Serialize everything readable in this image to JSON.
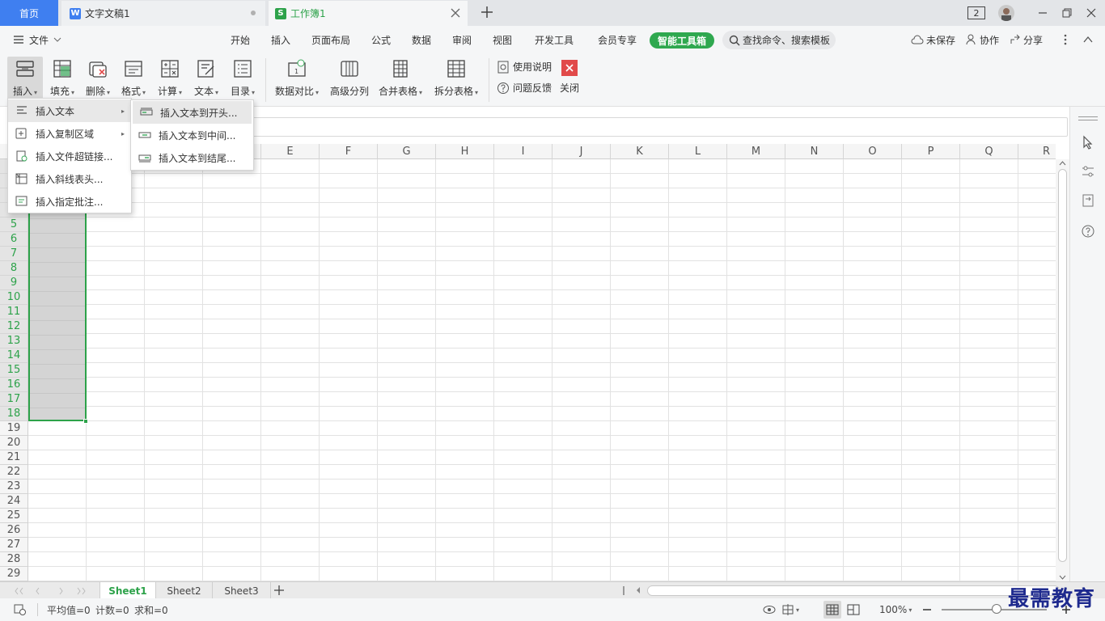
{
  "tabs": {
    "home": "首页",
    "doc": "文字文稿1",
    "sheet": "工作簿1",
    "window_count": "2"
  },
  "menu": {
    "file": "文件",
    "items": [
      "开始",
      "插入",
      "页面布局",
      "公式",
      "数据",
      "审阅",
      "视图",
      "开发工具",
      "会员专享"
    ],
    "smart_toolbox": "智能工具箱",
    "search_placeholder": "查找命令、搜索模板",
    "unsaved": "未保存",
    "collaborate": "协作",
    "share": "分享"
  },
  "ribbon": {
    "buttons": [
      "插入",
      "填充",
      "删除",
      "格式",
      "计算",
      "文本",
      "目录",
      "数据对比",
      "高级分列",
      "合并表格",
      "拆分表格"
    ],
    "help": "使用说明",
    "feedback": "问题反馈",
    "close": "关闭"
  },
  "grid": {
    "columns": [
      "E",
      "F",
      "G",
      "H",
      "I",
      "J",
      "K",
      "L",
      "M",
      "N",
      "O",
      "P",
      "Q",
      "R"
    ],
    "rows": [
      "5",
      "6",
      "7",
      "8",
      "9",
      "10",
      "11",
      "12",
      "13",
      "14",
      "15",
      "16",
      "17",
      "18",
      "19",
      "20",
      "21",
      "22",
      "23",
      "24",
      "25",
      "26",
      "27",
      "28",
      "29"
    ]
  },
  "insert_menu": {
    "items": [
      "插入文本",
      "插入复制区域",
      "插入文件超链接...",
      "插入斜线表头...",
      "插入指定批注..."
    ]
  },
  "insert_text_submenu": {
    "items": [
      "插入文本到开头...",
      "插入文本到中间...",
      "插入文本到结尾..."
    ]
  },
  "sheets": [
    "Sheet1",
    "Sheet2",
    "Sheet3"
  ],
  "status": {
    "average": "平均值=0",
    "count": "计数=0",
    "sum": "求和=0",
    "zoom": "100%"
  },
  "watermark": "最需教育",
  "colors": {
    "accent": "#2da24a",
    "home_tab": "#3f7ff0",
    "close_red": "#e14a4a"
  }
}
